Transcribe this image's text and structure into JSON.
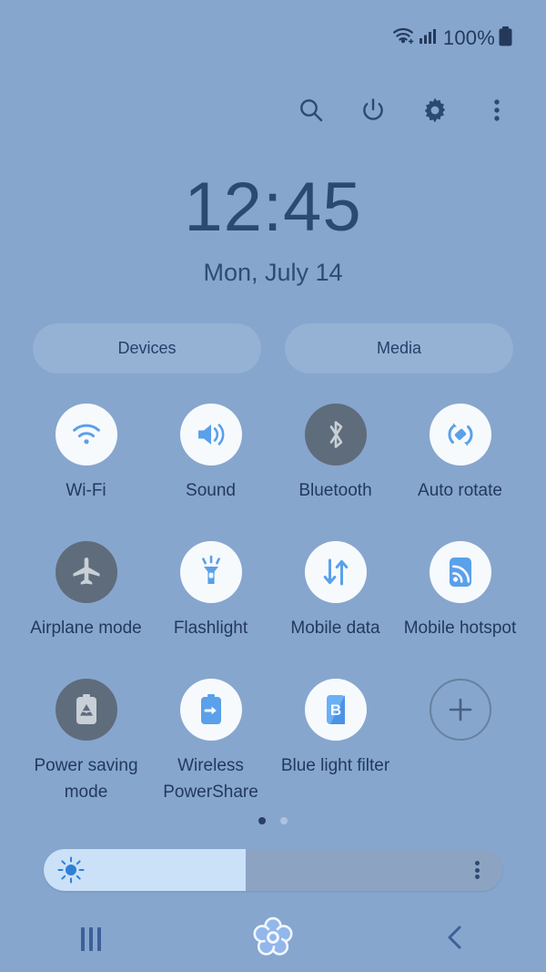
{
  "status_bar": {
    "wifi_icon": "wifi-icon",
    "signal_icon": "cellular-signal-icon",
    "battery_percent": "100%",
    "battery_icon": "battery-full-icon"
  },
  "header": {
    "icons": [
      {
        "name": "search-icon",
        "label": "Search"
      },
      {
        "name": "power-icon",
        "label": "Power off"
      },
      {
        "name": "gear-icon",
        "label": "Settings"
      },
      {
        "name": "more-options-icon",
        "label": "More options"
      }
    ]
  },
  "clock": {
    "time": "12:45",
    "date": "Mon, July 14"
  },
  "pills": [
    {
      "label": "Devices",
      "name": "devices-pill"
    },
    {
      "label": "Media",
      "name": "media-pill"
    }
  ],
  "tiles": [
    {
      "label": "Wi-Fi",
      "icon": "wifi-icon",
      "state": "on"
    },
    {
      "label": "Sound",
      "icon": "sound-icon",
      "state": "on"
    },
    {
      "label": "Bluetooth",
      "icon": "bluetooth-icon",
      "state": "off"
    },
    {
      "label": "Auto rotate",
      "icon": "auto-rotate-icon",
      "state": "on"
    },
    {
      "label": "Airplane mode",
      "icon": "airplane-icon",
      "state": "off"
    },
    {
      "label": "Flashlight",
      "icon": "flashlight-icon",
      "state": "on"
    },
    {
      "label": "Mobile data",
      "icon": "mobile-data-icon",
      "state": "on"
    },
    {
      "label": "Mobile hotspot",
      "icon": "mobile-hotspot-icon",
      "state": "on"
    },
    {
      "label": "Power saving mode",
      "icon": "power-saving-icon",
      "state": "off"
    },
    {
      "label": "Wireless PowerShare",
      "icon": "wireless-powershare-icon",
      "state": "on"
    },
    {
      "label": "Blue light filter",
      "icon": "blue-light-filter-icon",
      "state": "on"
    },
    {
      "label": "",
      "icon": "add-icon",
      "state": "add"
    }
  ],
  "page_indicator": {
    "total": 2,
    "active_index": 0
  },
  "brightness": {
    "icon": "brightness-sun-icon",
    "value_percent": 44,
    "menu_icon": "more-options-icon"
  },
  "nav_bar": [
    {
      "name": "recents-button",
      "icon": "recents-icon"
    },
    {
      "name": "home-button",
      "icon": "flower-home-icon"
    },
    {
      "name": "back-button",
      "icon": "back-chevron-icon"
    }
  ],
  "colors": {
    "background": "#86a6ce",
    "tile_on": "#f7fafd",
    "tile_off": "#5f6c7b",
    "accent_blue": "#4a9cf0",
    "text_dark": "#24395a",
    "slider_fill": "#cbe1f7",
    "slider_track": "#8ca4c2"
  }
}
